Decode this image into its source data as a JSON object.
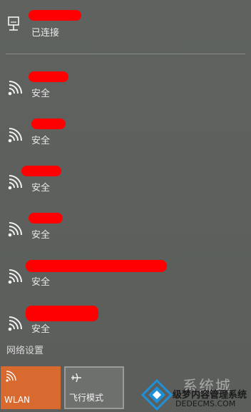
{
  "connected": {
    "status": "已连接"
  },
  "networks": [
    {
      "status": "安全"
    },
    {
      "status": "安全"
    },
    {
      "status": "安全"
    },
    {
      "status": "安全"
    },
    {
      "status": "安全"
    },
    {
      "status": "安全"
    }
  ],
  "footer": {
    "settings_link": "网络设置"
  },
  "quick_actions": {
    "wlan": {
      "label": "WLAN",
      "icon": "wifi-icon",
      "active": true,
      "color": "#d86a30"
    },
    "airplane": {
      "label": "飞行模式",
      "icon": "airplane-icon",
      "active": false
    }
  },
  "watermark": {
    "main": "系统城",
    "sub1": "级梦内容管理系统",
    "sub2": "DEDECMS.COM"
  },
  "colors": {
    "redaction": "#ff0000",
    "accent": "#d86a30",
    "background": "#5d605d"
  }
}
